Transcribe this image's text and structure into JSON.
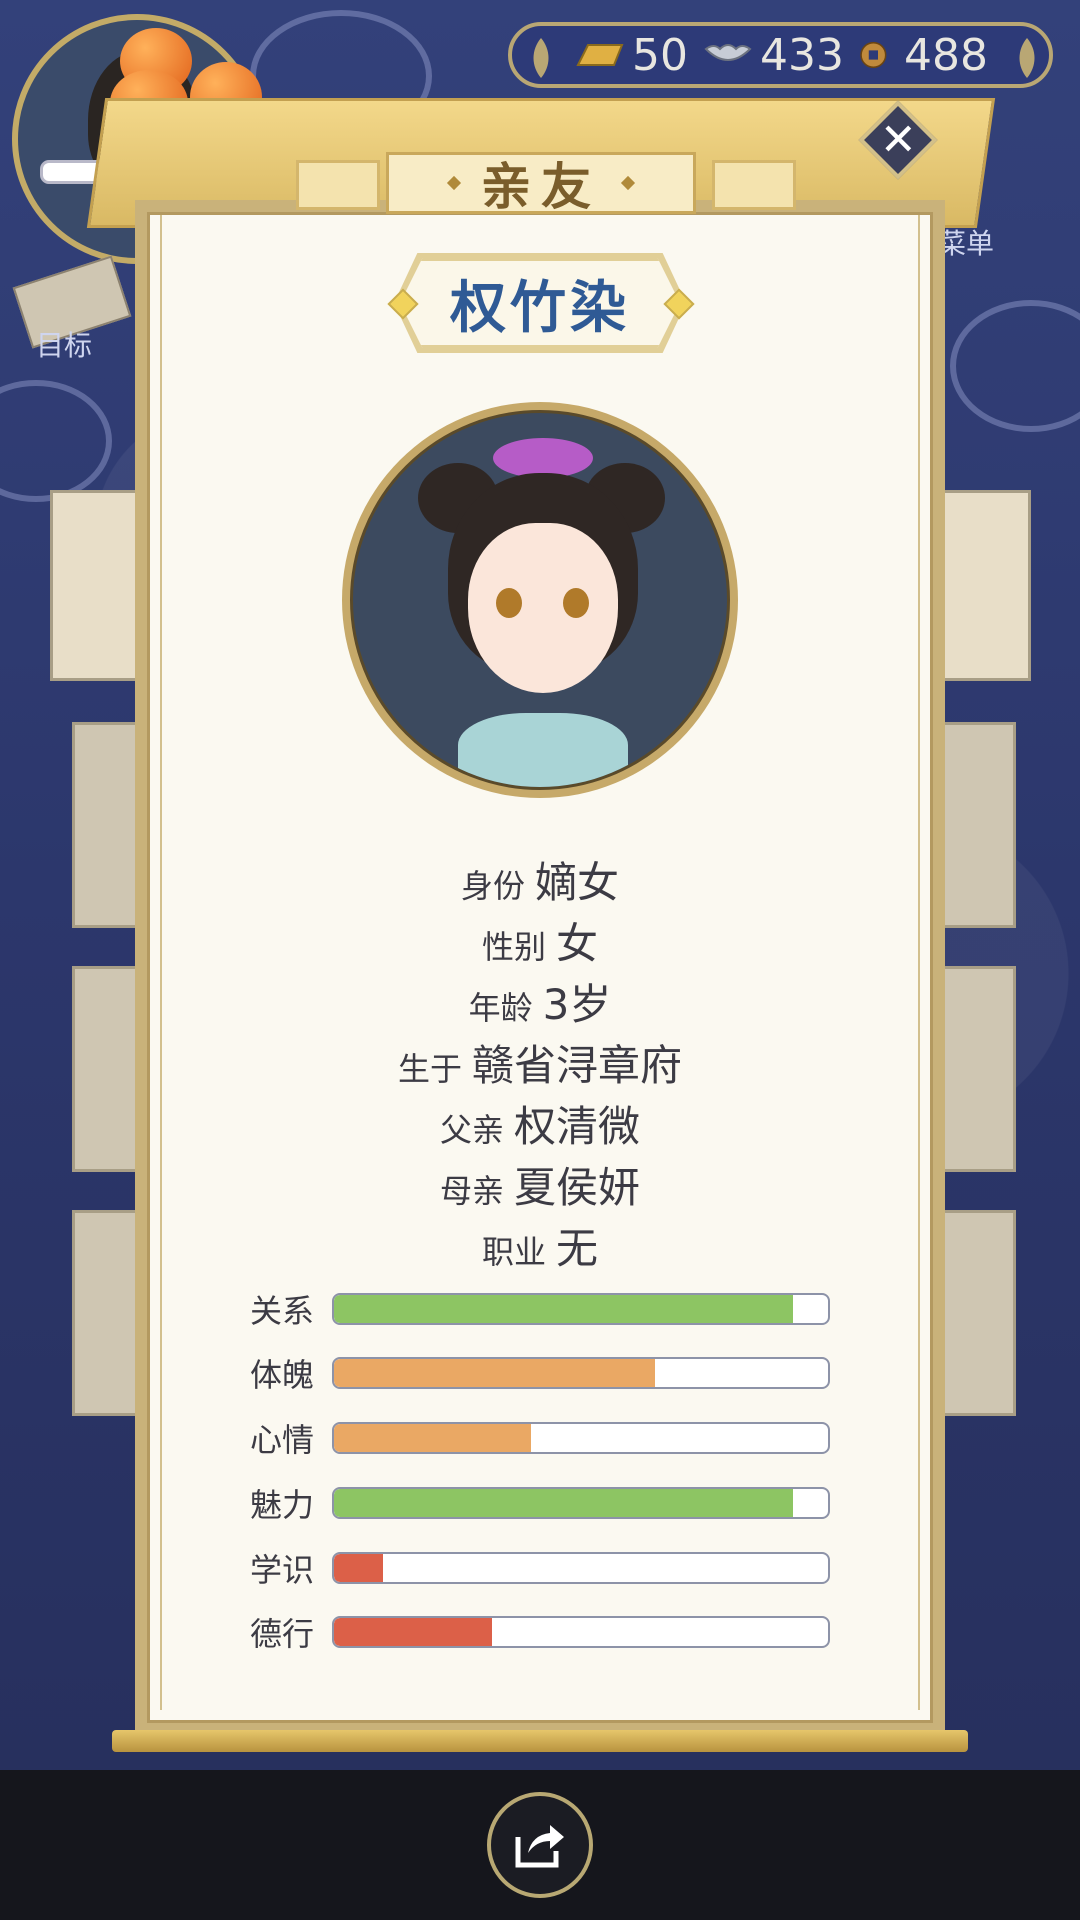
{
  "currency": {
    "gold": "50",
    "silver": "433",
    "coins": "488"
  },
  "side": {
    "goal_label": "目标",
    "menu_label": "菜单"
  },
  "panel": {
    "title": "亲友",
    "name": "权竹染"
  },
  "info": [
    {
      "label": "身份",
      "value": "嫡女"
    },
    {
      "label": "性别",
      "value": "女"
    },
    {
      "label": "年龄",
      "value": "3岁"
    },
    {
      "label": "生于",
      "value": "赣省浔章府"
    },
    {
      "label": "父亲",
      "value": "权清微"
    },
    {
      "label": "母亲",
      "value": "夏侯妍"
    },
    {
      "label": "职业",
      "value": "无"
    }
  ],
  "stats": [
    {
      "label": "关系",
      "fraction": 0.93,
      "color": "#8dc563"
    },
    {
      "label": "体魄",
      "fraction": 0.65,
      "color": "#eaa864"
    },
    {
      "label": "心情",
      "fraction": 0.4,
      "color": "#eaa864"
    },
    {
      "label": "魅力",
      "fraction": 0.93,
      "color": "#8dc563"
    },
    {
      "label": "学识",
      "fraction": 0.1,
      "color": "#dc6048"
    },
    {
      "label": "德行",
      "fraction": 0.32,
      "color": "#dc6048"
    }
  ],
  "icons": {
    "close": "close-icon",
    "share": "share-icon",
    "gold": "gold-ingot-icon",
    "silver": "silver-ingot-icon",
    "coin": "copper-coin-icon"
  }
}
